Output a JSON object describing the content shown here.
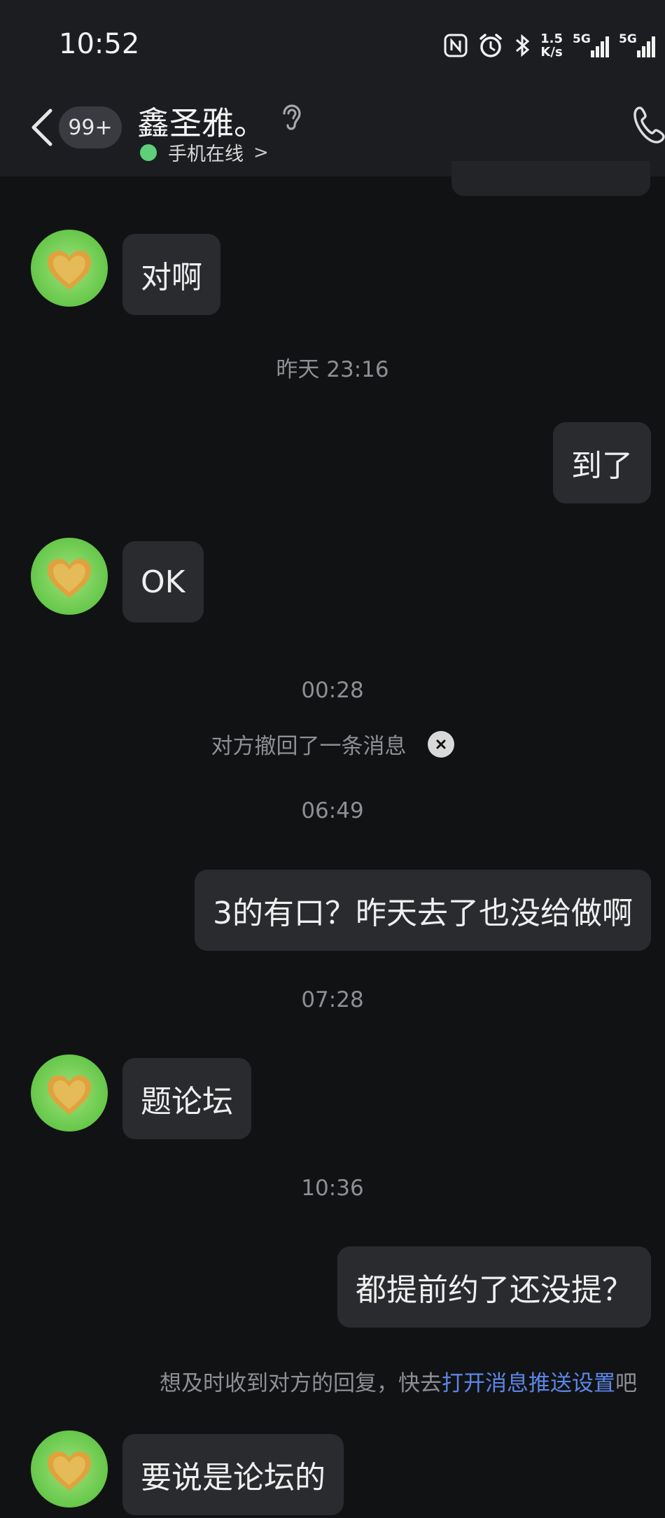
{
  "status_bar": {
    "time": "10:52",
    "net_speed_value": "1.5",
    "net_speed_unit": "K/s",
    "network_1": "5G",
    "network_2": "5G"
  },
  "header": {
    "unread_badge": "99+",
    "contact_name": "鑫圣雅。",
    "online_status": "手机在线",
    "online_chevron": ">"
  },
  "messages": [
    {
      "from": "contact",
      "text": "对啊"
    },
    {
      "timestamp": "昨天 23:16"
    },
    {
      "from": "me",
      "text": "到了"
    },
    {
      "from": "contact",
      "text": "OK"
    },
    {
      "timestamp": "00:28"
    },
    {
      "system": "对方撤回了一条消息"
    },
    {
      "timestamp": "06:49"
    },
    {
      "from": "me",
      "text": "3的有口？昨天去了也没给做啊"
    },
    {
      "timestamp": "07:28"
    },
    {
      "from": "contact",
      "text": "题论坛"
    },
    {
      "timestamp": "10:36"
    },
    {
      "from": "me",
      "text": "都提前约了还没提？"
    },
    {
      "from": "contact",
      "text": "要说是论坛的"
    }
  ],
  "notice": {
    "prefix": "想及时收到对方的回复，快去",
    "link": "打开消息推送设置",
    "suffix": "吧"
  },
  "colors": {
    "background": "#111214",
    "header": "#1c1d21",
    "bubble": "#2a2b2f",
    "online_dot": "#5ed07a",
    "link": "#5b86e6"
  }
}
